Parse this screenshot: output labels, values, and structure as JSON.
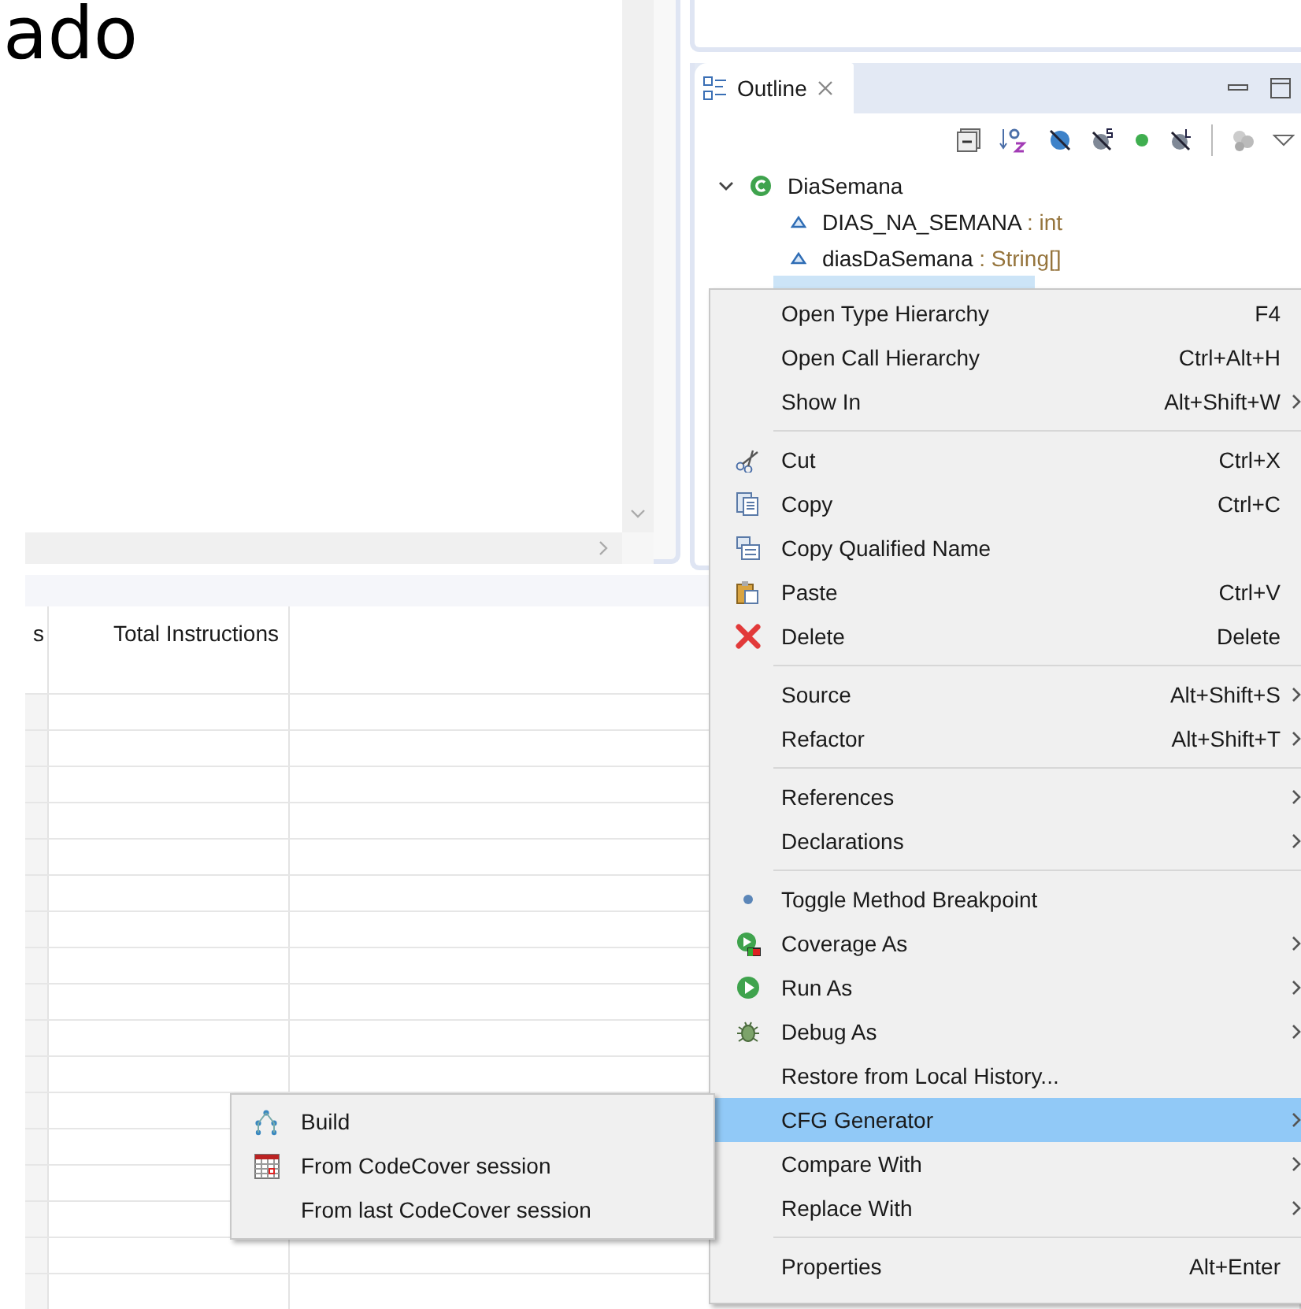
{
  "title_fragment": "ado",
  "outline": {
    "tab": {
      "label": "Outline"
    },
    "tree": [
      {
        "name": "DiaSemana",
        "expanded": true,
        "selected": false,
        "children": [
          {
            "name": "DIAS_NA_SEMANA",
            "type": " : int",
            "selected": false
          },
          {
            "name": "diasDaSemana",
            "type": " : String[]",
            "selected": false
          },
          {
            "selected": true
          }
        ]
      }
    ]
  },
  "table": {
    "columns": [
      "s",
      "Total Instructions"
    ]
  },
  "context_menu": {
    "items": [
      {
        "kind": "item",
        "label": "Open Type Hierarchy",
        "shortcut": "F4",
        "submenu": false,
        "selected": false
      },
      {
        "kind": "item",
        "label": "Open Call Hierarchy",
        "shortcut": "Ctrl+Alt+H",
        "submenu": false,
        "selected": false
      },
      {
        "kind": "item",
        "label": "Show In",
        "shortcut": "Alt+Shift+W",
        "submenu": true,
        "selected": false
      },
      {
        "kind": "separator"
      },
      {
        "kind": "item",
        "label": "Cut",
        "shortcut": "Ctrl+X",
        "submenu": false,
        "selected": false
      },
      {
        "kind": "item",
        "label": "Copy",
        "shortcut": "Ctrl+C",
        "submenu": false,
        "selected": false
      },
      {
        "kind": "item",
        "label": "Copy Qualified Name",
        "submenu": false,
        "selected": false
      },
      {
        "kind": "item",
        "label": "Paste",
        "shortcut": "Ctrl+V",
        "submenu": false,
        "selected": false
      },
      {
        "kind": "item",
        "label": "Delete",
        "shortcut": "Delete",
        "submenu": false,
        "selected": false
      },
      {
        "kind": "separator"
      },
      {
        "kind": "item",
        "label": "Source",
        "shortcut": "Alt+Shift+S",
        "submenu": true,
        "selected": false
      },
      {
        "kind": "item",
        "label": "Refactor",
        "shortcut": "Alt+Shift+T",
        "submenu": true,
        "selected": false
      },
      {
        "kind": "separator"
      },
      {
        "kind": "item",
        "label": "References",
        "submenu": true,
        "selected": false
      },
      {
        "kind": "item",
        "label": "Declarations",
        "submenu": true,
        "selected": false
      },
      {
        "kind": "separator"
      },
      {
        "kind": "item",
        "label": "Toggle Method Breakpoint",
        "submenu": false,
        "selected": false
      },
      {
        "kind": "item",
        "label": "Coverage As",
        "submenu": true,
        "selected": false
      },
      {
        "kind": "item",
        "label": "Run As",
        "submenu": true,
        "selected": false
      },
      {
        "kind": "item",
        "label": "Debug As",
        "submenu": true,
        "selected": false
      },
      {
        "kind": "item",
        "label": "Restore from Local History...",
        "submenu": false,
        "selected": false
      },
      {
        "kind": "item",
        "label": "CFG Generator",
        "submenu": true,
        "selected": true
      },
      {
        "kind": "item",
        "label": "Compare With",
        "submenu": true,
        "selected": false
      },
      {
        "kind": "item",
        "label": "Replace With",
        "submenu": true,
        "selected": false
      },
      {
        "kind": "separator"
      },
      {
        "kind": "item",
        "label": "Properties",
        "shortcut": "Alt+Enter",
        "submenu": false,
        "selected": false
      }
    ]
  },
  "submenu": {
    "items": [
      {
        "label": "Build",
        "selected": false
      },
      {
        "label": "From CodeCover session",
        "selected": false
      },
      {
        "label": "From last CodeCover session",
        "selected": false
      }
    ]
  }
}
